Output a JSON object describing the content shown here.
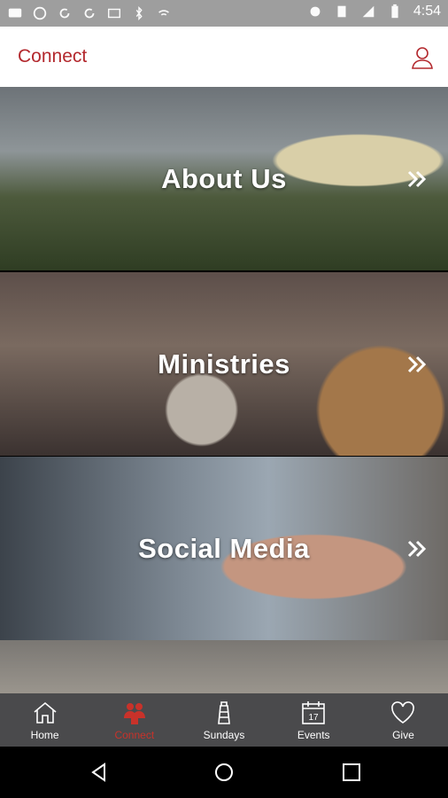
{
  "status_bar": {
    "time": "4:54",
    "left_icons": [
      "chat-icon",
      "wordpress-icon",
      "refresh-icon",
      "refresh-icon",
      "email-icon",
      "bluetooth-icon",
      "wifi-icon"
    ],
    "right_icons": [
      "circle-icon",
      "sim-icon",
      "signal-icon",
      "battery-icon"
    ]
  },
  "app_bar": {
    "title": "Connect",
    "accent": "#b3282d"
  },
  "tiles": [
    {
      "label": "About Us"
    },
    {
      "label": "Ministries"
    },
    {
      "label": "Social Media"
    }
  ],
  "tab_bar": {
    "items": [
      {
        "label": "Home",
        "icon": "home-icon"
      },
      {
        "label": "Connect",
        "icon": "people-icon",
        "active": true
      },
      {
        "label": "Sundays",
        "icon": "lighthouse-icon"
      },
      {
        "label": "Events",
        "icon": "calendar-icon",
        "calendar_day": "17"
      },
      {
        "label": "Give",
        "icon": "heart-icon"
      }
    ]
  }
}
